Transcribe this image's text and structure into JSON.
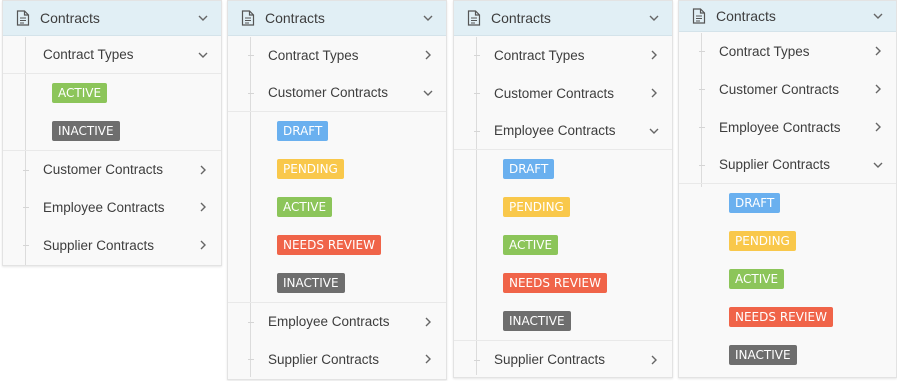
{
  "colors": {
    "header_bg": "#e1eff5",
    "panel_bg": "#f9f9f9",
    "draft": "#6ab0ef",
    "pending": "#f9c84b",
    "active": "#8cc55a",
    "needs_review": "#f06449",
    "inactive": "#6e6e6e"
  },
  "panels": [
    {
      "header": {
        "title": "Contracts",
        "icon": "document-icon",
        "chevron": "chevron-down-icon"
      },
      "items": [
        {
          "label": "Contract Types",
          "chevron": "chevron-down-icon",
          "expanded": true
        },
        {
          "label": "Customer Contracts",
          "chevron": "chevron-right-icon"
        },
        {
          "label": "Employee Contracts",
          "chevron": "chevron-right-icon"
        },
        {
          "label": "Supplier Contracts",
          "chevron": "chevron-right-icon"
        }
      ],
      "badges": [
        "ACTIVE",
        "INACTIVE"
      ]
    },
    {
      "header": {
        "title": "Contracts",
        "icon": "document-icon",
        "chevron": "chevron-down-icon"
      },
      "items": [
        {
          "label": "Contract Types",
          "chevron": "chevron-right-icon"
        },
        {
          "label": "Customer Contracts",
          "chevron": "chevron-down-icon",
          "expanded": true
        },
        {
          "label": "Employee Contracts",
          "chevron": "chevron-right-icon"
        },
        {
          "label": "Supplier Contracts",
          "chevron": "chevron-right-icon"
        }
      ],
      "badges": [
        "DRAFT",
        "PENDING",
        "ACTIVE",
        "NEEDS REVIEW",
        "INACTIVE"
      ]
    },
    {
      "header": {
        "title": "Contracts",
        "icon": "document-icon",
        "chevron": "chevron-down-icon"
      },
      "items": [
        {
          "label": "Contract Types",
          "chevron": "chevron-right-icon"
        },
        {
          "label": "Customer Contracts",
          "chevron": "chevron-right-icon"
        },
        {
          "label": "Employee Contracts",
          "chevron": "chevron-down-icon",
          "expanded": true
        },
        {
          "label": "Supplier Contracts",
          "chevron": "chevron-right-icon"
        }
      ],
      "badges": [
        "DRAFT",
        "PENDING",
        "ACTIVE",
        "NEEDS REVIEW",
        "INACTIVE"
      ]
    },
    {
      "header": {
        "title": "Contracts",
        "icon": "document-icon",
        "chevron": "chevron-down-icon"
      },
      "items": [
        {
          "label": "Contract Types",
          "chevron": "chevron-right-icon"
        },
        {
          "label": "Customer Contracts",
          "chevron": "chevron-right-icon"
        },
        {
          "label": "Employee Contracts",
          "chevron": "chevron-right-icon"
        },
        {
          "label": "Supplier Contracts",
          "chevron": "chevron-down-icon",
          "expanded": true
        }
      ],
      "badges": [
        "DRAFT",
        "PENDING",
        "ACTIVE",
        "NEEDS REVIEW",
        "INACTIVE"
      ]
    }
  ]
}
